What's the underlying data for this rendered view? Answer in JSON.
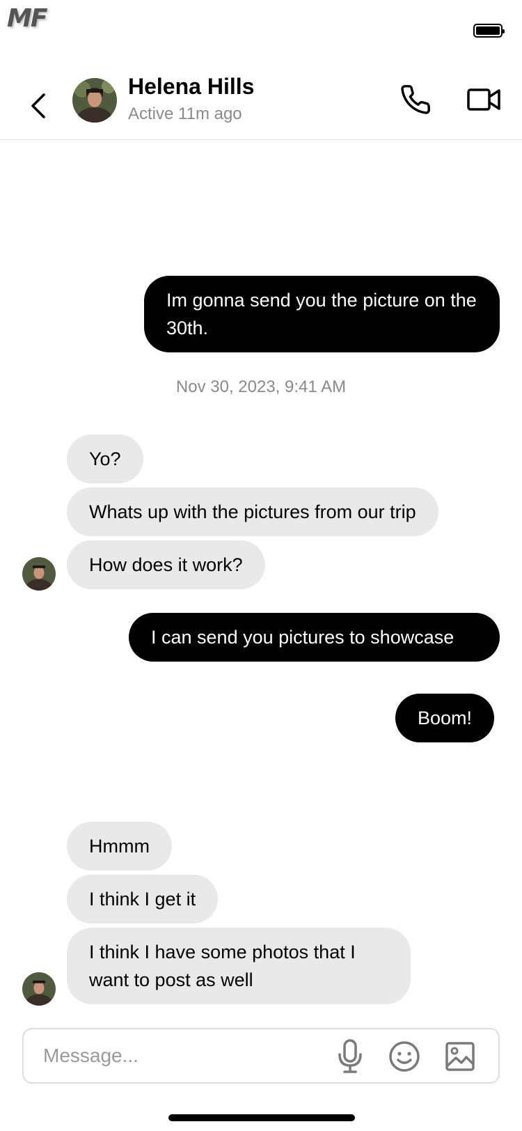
{
  "status_bar": {
    "logo_text": "MF",
    "battery_icon": "battery-full-icon"
  },
  "header": {
    "back_icon": "chevron-left-icon",
    "contact_name": "Helena Hills",
    "contact_status": "Active 11m ago",
    "call_icon": "phone-icon",
    "video_icon": "video-camera-icon"
  },
  "conversation": {
    "messages": [
      {
        "side": "sent",
        "text": "Im gonna send you the picture on the 30th."
      },
      {
        "side": "received",
        "text": "Yo?"
      },
      {
        "side": "received",
        "text": "Whats up with the pictures from our trip"
      },
      {
        "side": "received",
        "text": "How does it work?"
      },
      {
        "side": "sent",
        "text": "I can send you pictures to showcase"
      },
      {
        "side": "sent",
        "text": "Boom!"
      },
      {
        "side": "received",
        "text": "Hmmm"
      },
      {
        "side": "received",
        "text": "I think I get it"
      },
      {
        "side": "received",
        "text": "I think I have some photos that I want to post as well"
      }
    ],
    "timestamp": "Nov 30, 2023, 9:41 AM"
  },
  "composer": {
    "placeholder": "Message...",
    "value": "",
    "mic_icon": "microphone-icon",
    "emoji_icon": "smiley-icon",
    "image_icon": "image-icon"
  },
  "colors": {
    "sent_bubble": "#000000",
    "received_bubble": "#e9e9eb",
    "muted_text": "#8a8a8a"
  }
}
